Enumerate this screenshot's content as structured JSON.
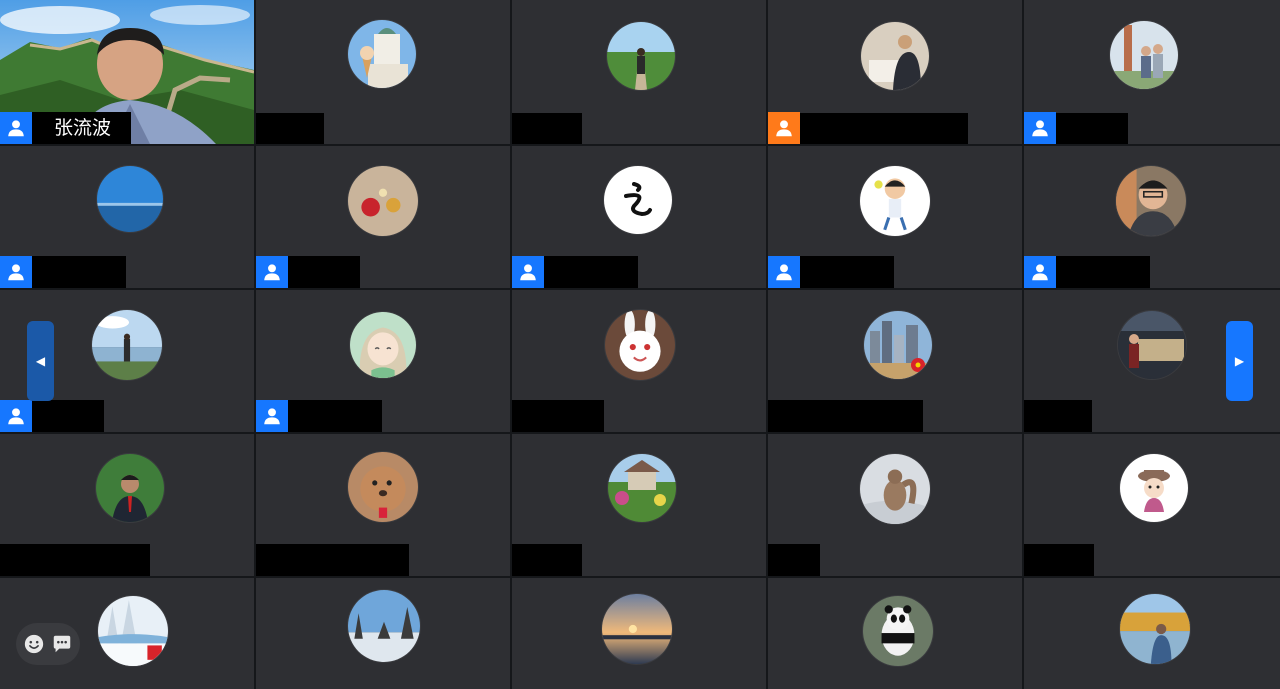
{
  "meeting": {
    "video_participant_name": "张流波",
    "nav": {
      "prev_glyph": "◀",
      "next_glyph": "▶"
    },
    "icons": {
      "participant": "user-icon",
      "emoji": "emoji-icon",
      "chat": "chat-icon",
      "prev": "chevron-left-icon",
      "next": "chevron-right-icon"
    },
    "colors": {
      "accent": "#1677ff",
      "accent_alt": "#ff7a1a",
      "tile": "#2e2f33"
    }
  },
  "tiles": [
    {
      "id": "r1c1",
      "kind": "video"
    },
    {
      "id": "r1c2",
      "kind": "avatar",
      "icon": "none",
      "avatar": "ice-cream-cathedral"
    },
    {
      "id": "r1c3",
      "kind": "avatar",
      "icon": "none",
      "avatar": "person-on-path"
    },
    {
      "id": "r1c4",
      "kind": "avatar",
      "icon": "orange",
      "avatar": "man-at-desk"
    },
    {
      "id": "r1c5",
      "kind": "avatar",
      "icon": "blue",
      "avatar": "family-outdoors"
    },
    {
      "id": "r2c1",
      "kind": "avatar",
      "icon": "blue",
      "avatar": "sky-and-sea"
    },
    {
      "id": "r2c2",
      "kind": "avatar",
      "icon": "blue",
      "avatar": "ornaments"
    },
    {
      "id": "r2c3",
      "kind": "avatar",
      "icon": "blue",
      "avatar": "calligraphy-character"
    },
    {
      "id": "r2c4",
      "kind": "avatar",
      "icon": "blue",
      "avatar": "cartoon-boy"
    },
    {
      "id": "r2c5",
      "kind": "avatar",
      "icon": "blue",
      "avatar": "man-with-glasses"
    },
    {
      "id": "r3c1",
      "kind": "avatar",
      "icon": "blue",
      "avatar": "person-by-lake"
    },
    {
      "id": "r3c2",
      "kind": "avatar",
      "icon": "blue",
      "avatar": "anime-girl"
    },
    {
      "id": "r3c3",
      "kind": "avatar",
      "icon": "none",
      "avatar": "white-rabbit"
    },
    {
      "id": "r3c4",
      "kind": "avatar",
      "icon": "none",
      "avatar": "city-skyline"
    },
    {
      "id": "r3c5",
      "kind": "avatar",
      "icon": "none",
      "avatar": "museum-visitor"
    },
    {
      "id": "r4c1",
      "kind": "avatar",
      "icon": "none",
      "avatar": "man-in-suit"
    },
    {
      "id": "r4c2",
      "kind": "avatar",
      "icon": "none",
      "avatar": "poodle"
    },
    {
      "id": "r4c3",
      "kind": "avatar",
      "icon": "none",
      "avatar": "garden-house"
    },
    {
      "id": "r4c4",
      "kind": "avatar",
      "icon": "none",
      "avatar": "squirrel-in-snow"
    },
    {
      "id": "r4c5",
      "kind": "avatar",
      "icon": "none",
      "avatar": "cartoon-hat-character"
    },
    {
      "id": "r5c1",
      "kind": "avatar",
      "icon": "none",
      "avatar": "snowy-trees"
    },
    {
      "id": "r5c2",
      "kind": "avatar",
      "icon": "none",
      "avatar": "winter-forest"
    },
    {
      "id": "r5c3",
      "kind": "avatar",
      "icon": "none",
      "avatar": "sunset-sea"
    },
    {
      "id": "r5c4",
      "kind": "avatar",
      "icon": "none",
      "avatar": "panda"
    },
    {
      "id": "r5c5",
      "kind": "avatar",
      "icon": "none",
      "avatar": "autumn-lake"
    }
  ]
}
